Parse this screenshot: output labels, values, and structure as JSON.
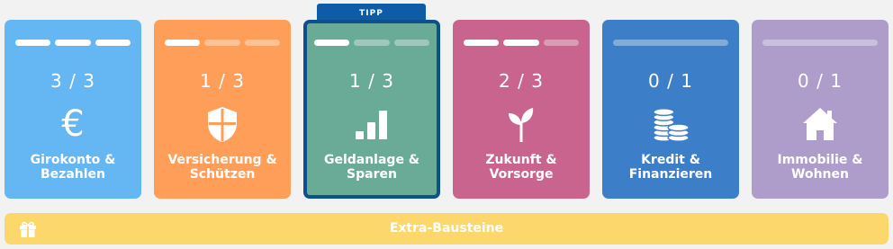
{
  "tipp_badge": "TIPP",
  "cards": [
    {
      "count": "3 / 3",
      "label_line1": "Girokonto &",
      "label_line2": "Bezahlen",
      "color": "#65b7f3",
      "icon": "euro-icon",
      "icon_glyph": "€",
      "progress_done": 3,
      "progress_total": 3
    },
    {
      "count": "1 / 3",
      "label_line1": "Versicherung &",
      "label_line2": "Schützen",
      "color": "#ff9e58",
      "icon": "shield-icon",
      "progress_done": 1,
      "progress_total": 3
    },
    {
      "count": "1 / 3",
      "label_line1": "Geldanlage &",
      "label_line2": "Sparen",
      "color": "#6aab97",
      "icon": "signal-bars-icon",
      "progress_done": 1,
      "progress_total": 3,
      "highlight": true
    },
    {
      "count": "2 / 3",
      "label_line1": "Zukunft &",
      "label_line2": "Vorsorge",
      "color": "#c9648e",
      "icon": "sprout-icon",
      "progress_done": 2,
      "progress_total": 3
    },
    {
      "count": "0 / 1",
      "label_line1": "Kredit &",
      "label_line2": "Finanzieren",
      "color": "#3c7fc8",
      "icon": "coins-icon",
      "progress_done": 0,
      "progress_total": 1
    },
    {
      "count": "0 / 1",
      "label_line1": "Immobilie &",
      "label_line2": "Wohnen",
      "color": "#ae9dcb",
      "icon": "house-icon",
      "progress_done": 0,
      "progress_total": 1
    }
  ],
  "extra": {
    "label": "Extra-Bausteine",
    "color": "#fcd76b",
    "icon": "gift-icon"
  }
}
